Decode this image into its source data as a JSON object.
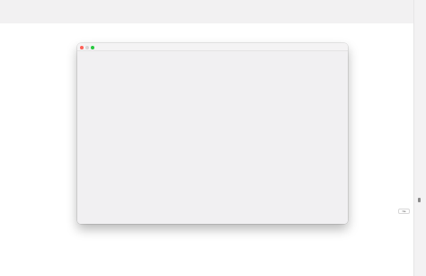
{
  "window": {
    "traffic_lights": {
      "close_color": "#fe5f57",
      "minimize_color": "#d7d5d6",
      "maximize_color": "#28c840"
    }
  },
  "side_panel": {
    "mini_button_label": "Na"
  },
  "icons": {
    "close": "close-icon",
    "minimize": "minimize-icon",
    "maximize": "maximize-icon",
    "handle": "panel-handle-icon"
  }
}
